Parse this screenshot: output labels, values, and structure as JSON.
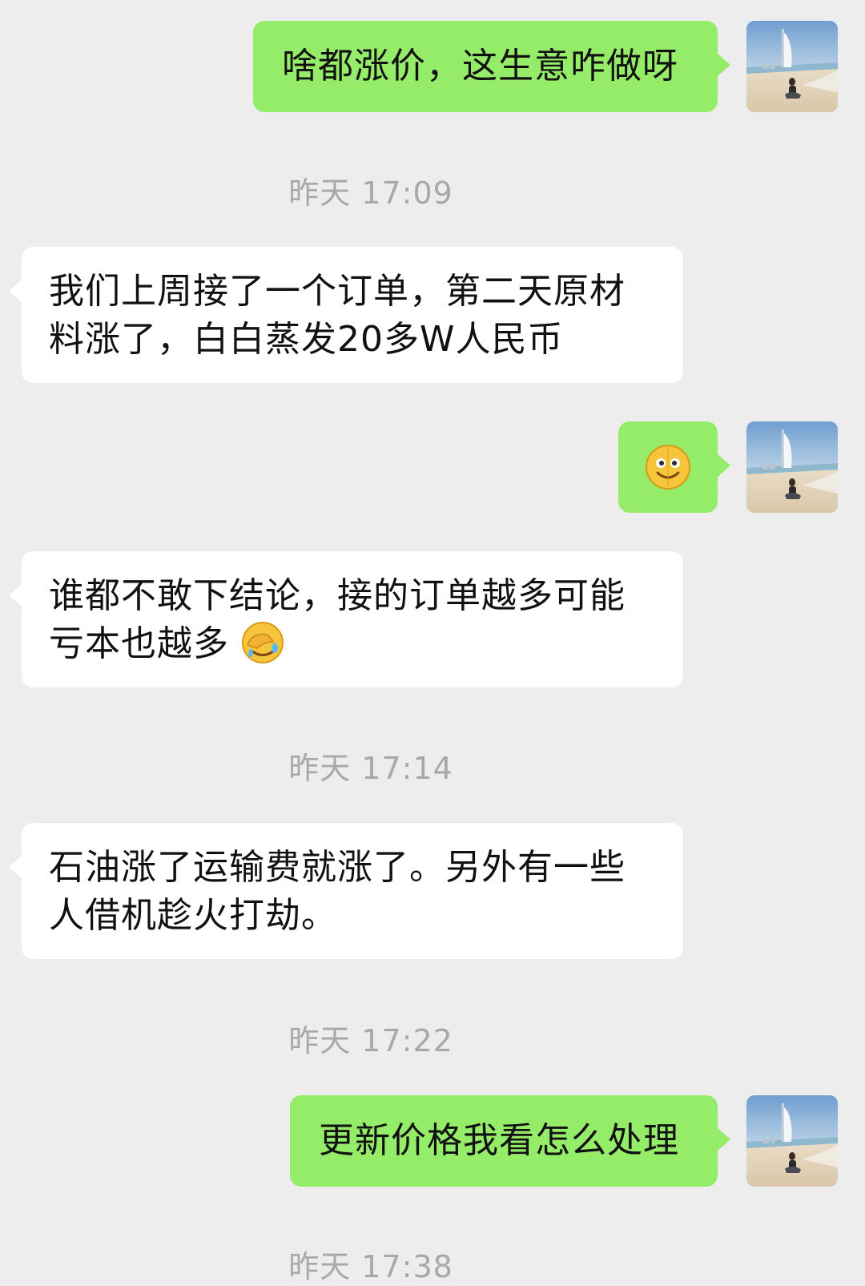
{
  "messages": [
    {
      "type": "outgoing",
      "text": "啥都涨价，这生意咋做呀"
    },
    {
      "type": "time",
      "text": "昨天 17:09"
    },
    {
      "type": "incoming",
      "text": "我们上周接了一个订单，第二天原材料涨了，白白蒸发20多W人民币"
    },
    {
      "type": "outgoing",
      "emoji": "smiley-emoji"
    },
    {
      "type": "incoming",
      "text": "谁都不敢下结论，接的订单越多可能亏本也越多",
      "emoji": "facepalm-emoji"
    },
    {
      "type": "time",
      "text": "昨天 17:14"
    },
    {
      "type": "incoming",
      "text": "石油涨了运输费就涨了。另外有一些人借机趁火打劫。"
    },
    {
      "type": "time",
      "text": "昨天 17:22"
    },
    {
      "type": "outgoing",
      "text": "更新价格我看怎么处理"
    },
    {
      "type": "time",
      "text": "昨天 17:38"
    }
  ],
  "colors": {
    "background": "#ededed",
    "outgoing_bubble": "#95ec69",
    "incoming_bubble": "#ffffff",
    "timestamp": "#a8a8a8"
  }
}
